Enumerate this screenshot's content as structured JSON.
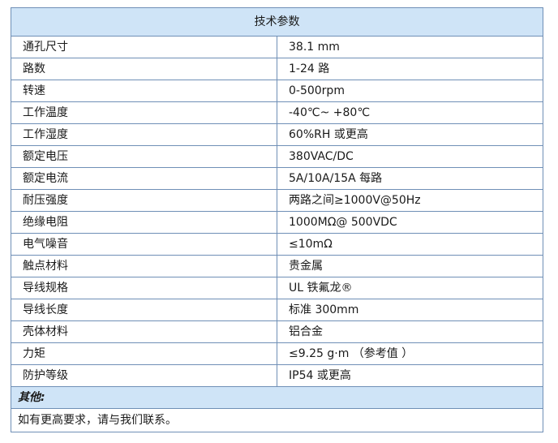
{
  "table": {
    "header": "技术参数",
    "rows": [
      {
        "label": "通孔尺寸",
        "value": "38.1 mm"
      },
      {
        "label": "路数",
        "value": "1-24 路"
      },
      {
        "label": "转速",
        "value": "0-500rpm"
      },
      {
        "label": "工作温度",
        "value": "-40℃~ +80℃"
      },
      {
        "label": "工作湿度",
        "value": "60%RH 或更高"
      },
      {
        "label": "额定电压",
        "value": "380VAC/DC"
      },
      {
        "label": "额定电流",
        "value": "5A/10A/15A 每路"
      },
      {
        "label": "耐压强度",
        "value": "两路之间≥1000V@50Hz"
      },
      {
        "label": "绝缘电阻",
        "value": "1000MΩ@ 500VDC"
      },
      {
        "label": "电气噪音",
        "value": "≤10mΩ"
      },
      {
        "label": "触点材料",
        "value": "贵金属"
      },
      {
        "label": "导线规格",
        "value": "UL 铁氟龙®"
      },
      {
        "label": "导线长度",
        "value": "标准 300mm"
      },
      {
        "label": "壳体材料",
        "value": "铝合金"
      },
      {
        "label": "力矩",
        "value": "≤9.25 g·m （参考值 ）"
      },
      {
        "label": "防护等级",
        "value": "IP54 或更高"
      }
    ],
    "other_label": "其他:",
    "other_note": "如有更高要求，请与我们联系。"
  },
  "colors": {
    "header_bg": "#cfe4f7",
    "border": "#6f8fb6"
  }
}
